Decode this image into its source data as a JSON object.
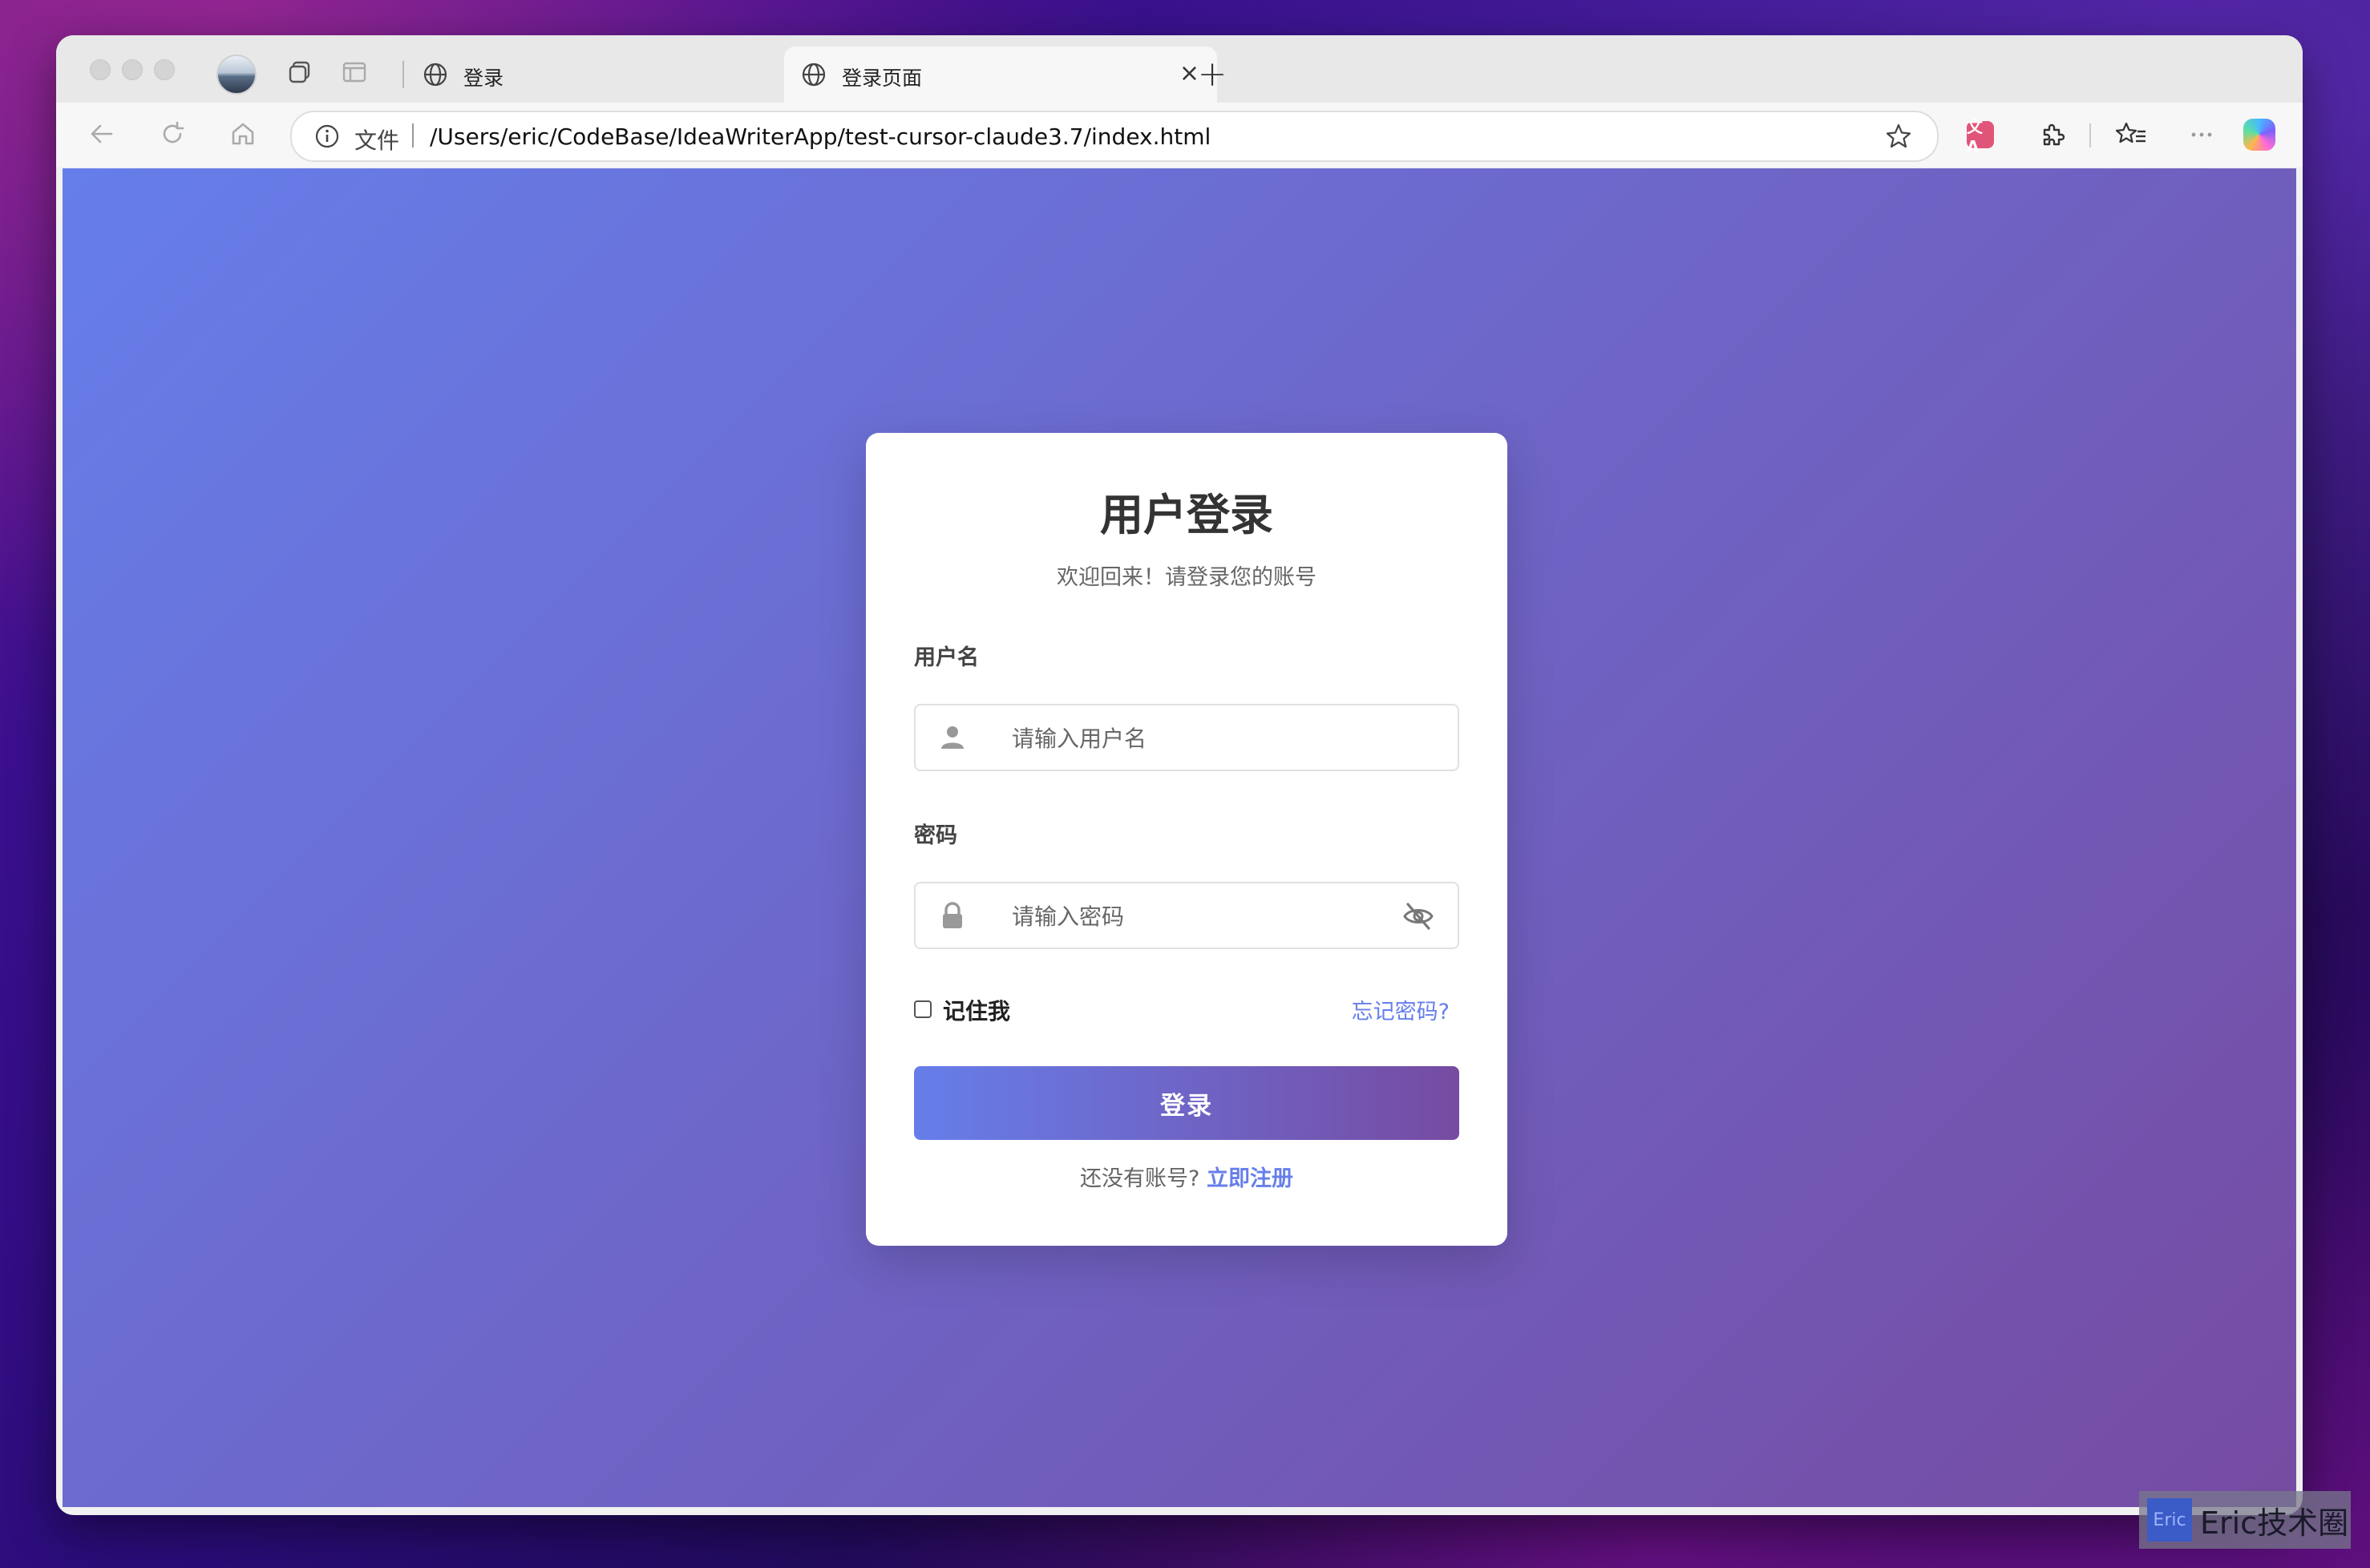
{
  "browser": {
    "tabs": [
      {
        "title": "登录",
        "close": "×",
        "active": false
      },
      {
        "title": "登录页面",
        "close": "×",
        "active": true
      }
    ],
    "new_tab": "+",
    "address_bar": {
      "scheme_label": "文件",
      "url": "/Users/eric/CodeBase/IdeaWriterApp/test-cursor-claude3.7/index.html"
    },
    "translate_badge": "文A",
    "icons": [
      "back-icon",
      "reload-icon",
      "home-icon",
      "info-icon",
      "favorite-star-icon",
      "translate-icon",
      "extensions-icon",
      "favorites-icon",
      "more-icon",
      "copilot-icon"
    ]
  },
  "login": {
    "title": "用户登录",
    "subtitle": "欢迎回来！请登录您的账号",
    "username_label": "用户名",
    "username_placeholder": "请输入用户名",
    "password_label": "密码",
    "password_placeholder": "请输入密码",
    "remember_label": "记住我",
    "remember_checked": false,
    "forgot_link": "忘记密码?",
    "submit_label": "登录",
    "register_prompt": "还没有账号?",
    "register_link": "立即注册"
  },
  "watermark": {
    "badge": "Eric",
    "text": "Eric技术圈"
  },
  "colors": {
    "gradient_start": "#667eea",
    "gradient_end": "#764ba2",
    "link": "#667eea"
  }
}
